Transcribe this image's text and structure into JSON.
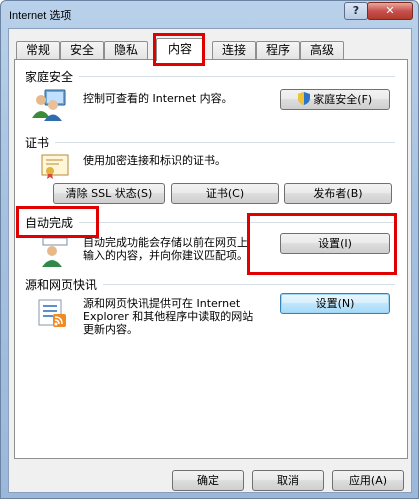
{
  "window": {
    "title": "Internet 选项",
    "help_label": "?",
    "close_label": "✕"
  },
  "tabs": [
    {
      "label": "常规"
    },
    {
      "label": "安全"
    },
    {
      "label": "隐私"
    },
    {
      "label": "内容"
    },
    {
      "label": "连接"
    },
    {
      "label": "程序"
    },
    {
      "label": "高级"
    }
  ],
  "active_tab": "内容",
  "family_safety": {
    "title": "家庭安全",
    "description": "控制可查看的 Internet 内容。",
    "button_label": "家庭安全(F)"
  },
  "certificates": {
    "title": "证书",
    "description": "使用加密连接和标识的证书。",
    "clear_ssl_label": "清除 SSL 状态(S)",
    "certificates_label": "证书(C)",
    "publishers_label": "发布者(B)"
  },
  "autocomplete": {
    "title": "自动完成",
    "description_line1": "自动完成功能会存储以前在网页上",
    "description_line2": "输入的内容，并向你建议匹配项。",
    "settings_label": "设置(I)"
  },
  "feeds": {
    "title": "源和网页快讯",
    "description_line1": "源和网页快讯提供可在 Internet",
    "description_line2": "Explorer 和其他程序中读取的网站",
    "description_line3": "更新内容。",
    "settings_label": "设置(N)"
  },
  "footer": {
    "ok_label": "确定",
    "cancel_label": "取消",
    "apply_label": "应用(A)"
  },
  "colors": {
    "highlight_box": "#e00000",
    "titlebar": "#b9d1ea"
  },
  "icons": {
    "family_safety": "family-users-icon",
    "shield": "shield-icon",
    "certificate": "certificate-icon",
    "autocomplete": "autocomplete-user-icon",
    "feeds": "feeds-icon"
  }
}
